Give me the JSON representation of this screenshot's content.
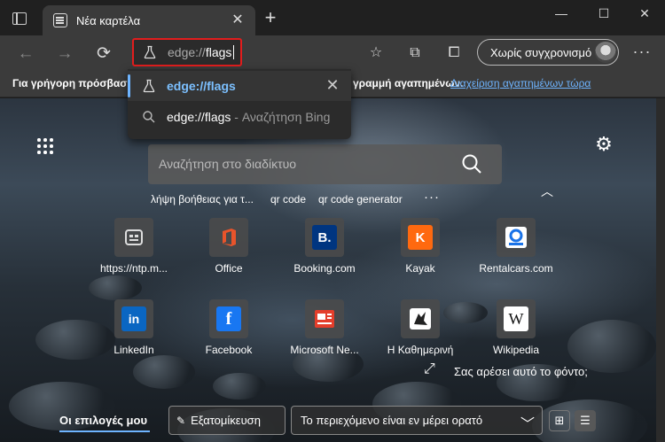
{
  "tab": {
    "title": "Νέα καρτέλα",
    "close": "✕"
  },
  "window": {
    "minimize": "—",
    "maximize": "☐",
    "close": "✕"
  },
  "toolbar": {
    "sync_label": "Χωρίς συγχρονισμό"
  },
  "address": {
    "prefix": "edge://",
    "typed": "flags"
  },
  "dropdown": {
    "items": [
      {
        "text": "edge://flags",
        "icon": "flask-icon"
      },
      {
        "text": "edge://flags",
        "suffix": " - Αναζήτηση Bing",
        "icon": "search-icon"
      }
    ]
  },
  "favbar": {
    "message_start": "Για γρήγορη πρόσβαση",
    "message_end": "γραμμή αγαπημένων.",
    "link": "Διαχείριση αγαπημένων τώρα"
  },
  "search": {
    "placeholder": "Αναζήτηση στο διαδίκτυο"
  },
  "suggestions": [
    "λήψη βοήθειας για τ...",
    "qr code",
    "qr code generator"
  ],
  "tiles": [
    {
      "label": "https://ntp.m...",
      "logo": "ntp-icon",
      "color": "#555555"
    },
    {
      "label": "Office",
      "logo": "office-icon",
      "color": "#d83b01"
    },
    {
      "label": "Booking.com",
      "logo": "booking-icon",
      "color": "#003580"
    },
    {
      "label": "Kayak",
      "logo": "kayak-icon",
      "color": "#ff690f"
    },
    {
      "label": "Rentalcars.com",
      "logo": "rentalcars-icon",
      "color": "#1a73e8"
    },
    {
      "label": "LinkedIn",
      "logo": "linkedin-icon",
      "color": "#0a66c2"
    },
    {
      "label": "Facebook",
      "logo": "facebook-icon",
      "color": "#1877f2"
    },
    {
      "label": "Microsoft Ne...",
      "logo": "microsoft-news-icon",
      "color": "#e43e2b"
    },
    {
      "label": "Η Καθημερινή",
      "logo": "kathimerini-icon",
      "color": "#ffffff"
    },
    {
      "label": "Wikipedia",
      "logo": "wikipedia-icon",
      "color": "#ffffff"
    }
  ],
  "tile_letters": {
    "booking": "B.",
    "kayak": "K",
    "linkedin": "in",
    "facebook": "f",
    "wikipedia": "W"
  },
  "background_question": "Σας αρέσει αυτό το φόντο;",
  "bottom": {
    "tab_options": "Οι επιλογές μου",
    "customize": "Εξατομίκευση",
    "content_visibility": "Το περιεχόμενο είναι εν μέρει ορατό"
  }
}
